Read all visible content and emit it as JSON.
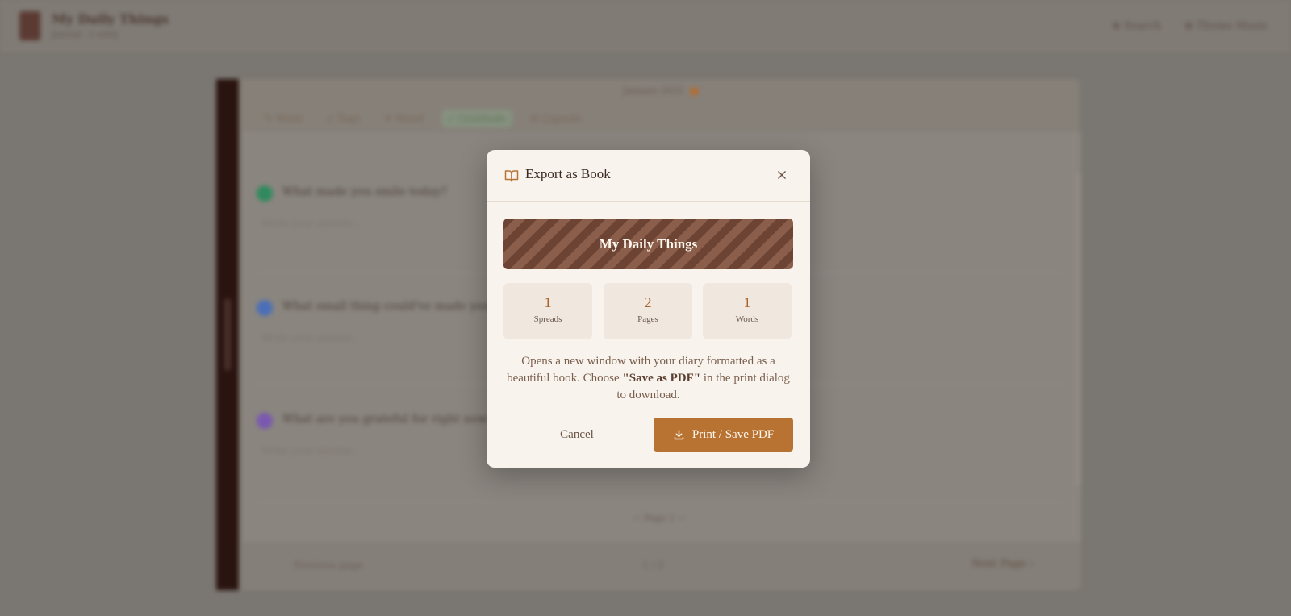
{
  "background": {
    "app": {
      "title": "My Daily Things",
      "subtitle": "Journal · 1 entry",
      "buttons": [
        "⊕ Search",
        "⊞ Theme Music"
      ]
    },
    "editor": {
      "date_chip": "January 2025",
      "tabs": [
        "✎ Write",
        "◇ Tags",
        "✦ Mood",
        "✓ Gratitude",
        "☺ Capsule"
      ],
      "prompts": [
        {
          "label": "What made you smile today?",
          "placeholder": "Write your answer...",
          "color": "#2f8a5e"
        },
        {
          "label": "What small thing could've made your day better?",
          "placeholder": "Write your answer...",
          "color": "#4a6fb8"
        },
        {
          "label": "What are you grateful for right now?",
          "placeholder": "Write your answer...",
          "color": "#7a58b0"
        }
      ],
      "page_number": "— Page 1 —",
      "nav": {
        "prev": "Previous page",
        "mid": "1 / 2",
        "next": "Next Page ›"
      }
    }
  },
  "modal": {
    "title": "Export as Book",
    "cover_title": "My Daily Things",
    "stats": [
      {
        "value": "1",
        "label": "Spreads"
      },
      {
        "value": "2",
        "label": "Pages"
      },
      {
        "value": "1",
        "label": "Words"
      }
    ],
    "description": {
      "before": "Opens a new window with your diary formatted as a beautiful book. Choose ",
      "emphasis": "\"Save as PDF\"",
      "after": " in the print dialog to download."
    },
    "cancel_label": "Cancel",
    "print_label": "Print / Save PDF"
  },
  "colors": {
    "accent": "#b87333",
    "cover_dark": "#6d4334",
    "cover_light": "#8b5e4b",
    "modal_bg": "#f8f3ec",
    "stat_bg": "#f0e8de"
  },
  "icons": [
    "book-open-icon",
    "close-icon",
    "download-icon"
  ]
}
